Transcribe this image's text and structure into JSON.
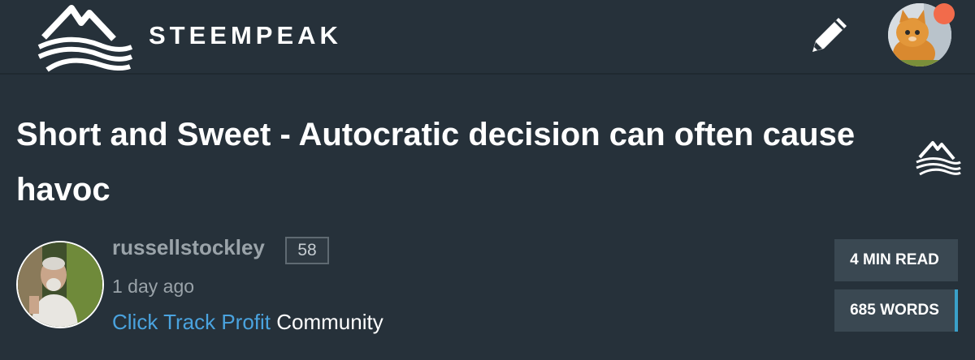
{
  "header": {
    "brand": "STEEMPEAK",
    "logo_icon": "steempeak-mountain-icon",
    "compose_icon": "pencil-icon",
    "profile_icon": "user-avatar",
    "notification_color": "#f26b4b"
  },
  "post": {
    "title": "Short and Sweet - Autocratic decision can often cause havoc",
    "source_icon": "steempeak-mountain-icon",
    "author": {
      "name": "russellstockley",
      "reputation": "58",
      "time": "1 day ago",
      "community_link": "Click Track Profit",
      "community_suffix": " Community"
    },
    "stats": {
      "read_time": "4 MIN READ",
      "words": "685 WORDS"
    }
  },
  "colors": {
    "background": "#26313a",
    "link": "#4aa3df",
    "accent": "#3aa0c9",
    "stat_bg": "#3a4852"
  }
}
